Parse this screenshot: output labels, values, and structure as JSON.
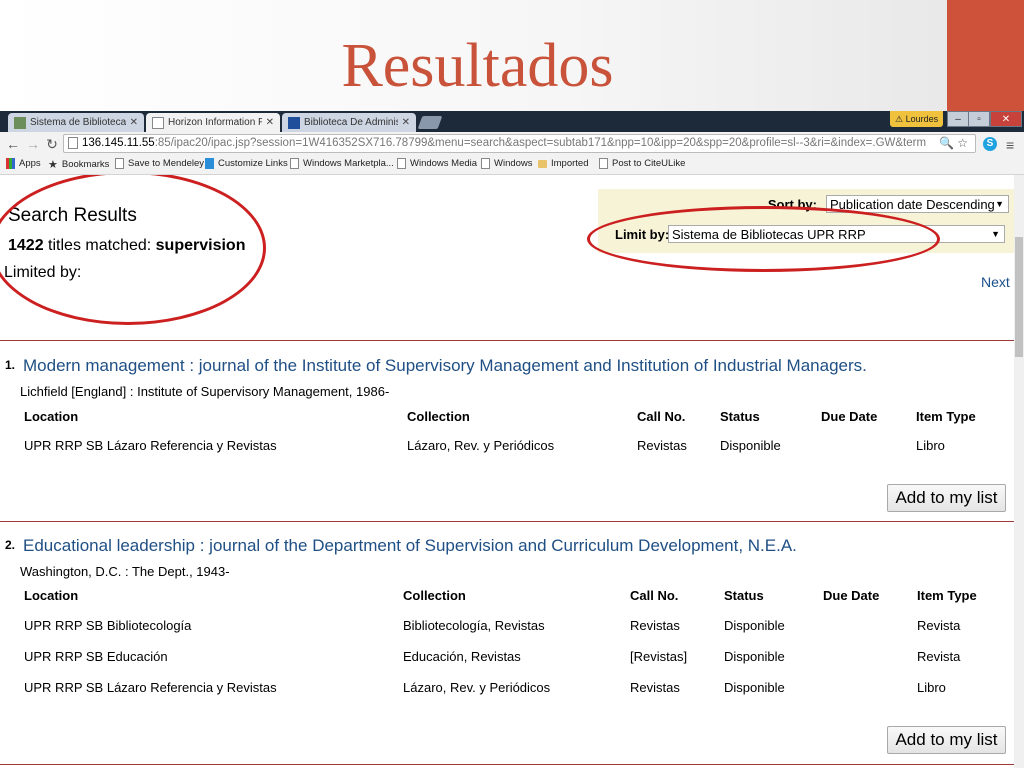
{
  "slide": {
    "title": "Resultados"
  },
  "browser": {
    "tabs": [
      {
        "label": "Sistema de Bibliotecas",
        "active": false
      },
      {
        "label": "Horizon Information Porta",
        "active": true
      },
      {
        "label": "Biblioteca De Administrac",
        "active": false
      }
    ],
    "user": "Lourdes",
    "url_host": "136.145.11.55",
    "url_rest": ":85/ipac20/ipac.jsp?session=1W416352SX716.78799&menu=search&aspect=subtab171&npp=10&ipp=20&spp=20&profile=sl--3&ri=&index=.GW&term",
    "bookmarks": [
      {
        "label": "Apps",
        "icon": "apps-grid-icon"
      },
      {
        "label": "Bookmarks",
        "icon": "star-icon"
      },
      {
        "label": "Save to Mendeley",
        "icon": "page-icon"
      },
      {
        "label": "Customize Links",
        "icon": "page-icon"
      },
      {
        "label": "Windows Marketpla...",
        "icon": "page-icon"
      },
      {
        "label": "Windows Media",
        "icon": "page-icon"
      },
      {
        "label": "Windows",
        "icon": "page-icon"
      },
      {
        "label": "Imported",
        "icon": "folder-icon"
      },
      {
        "label": "Post to CiteULike",
        "icon": "page-icon"
      }
    ]
  },
  "results": {
    "heading": "Search Results",
    "count": "1422",
    "count_text": "titles matched:",
    "term": "supervision",
    "limited_by": "Limited by:",
    "sort_label": "Sort by:",
    "sort_value": "Publication date Descending",
    "limit_label": "Limit by:",
    "limit_value": "Sistema de Bibliotecas UPR RRP",
    "next": "Next"
  },
  "table_headers": [
    "Location",
    "Collection",
    "Call No.",
    "Status",
    "Due Date",
    "Item Type"
  ],
  "records": [
    {
      "num": "1.",
      "title": "Modern management : journal of the Institute of Supervisory Management and Institution of Industrial Managers.",
      "pub": "Lichfield [England] : Institute of Supervisory Management, 1986-",
      "rows": [
        [
          "UPR RRP SB Lázaro Referencia y Revistas",
          "Lázaro, Rev. y Periódicos",
          "Revistas",
          "Disponible",
          "",
          "Libro"
        ]
      ],
      "add_label": "Add to my list"
    },
    {
      "num": "2.",
      "title": "Educational leadership : journal of the Department of Supervision and Curriculum Development, N.E.A.",
      "pub": "Washington, D.C. : The Dept., 1943-",
      "rows": [
        [
          "UPR RRP SB Bibliotecología",
          "Bibliotecología, Revistas",
          "Revistas",
          "Disponible",
          "",
          "Revista"
        ],
        [
          "UPR RRP SB Educación",
          "Educación, Revistas",
          "[Revistas]",
          "Disponible",
          "",
          "Revista"
        ],
        [
          "UPR RRP SB Lázaro Referencia y Revistas",
          "Lázaro, Rev. y Periódicos",
          "Revistas",
          "Disponible",
          "",
          "Libro"
        ]
      ],
      "add_label": "Add to my list"
    }
  ]
}
